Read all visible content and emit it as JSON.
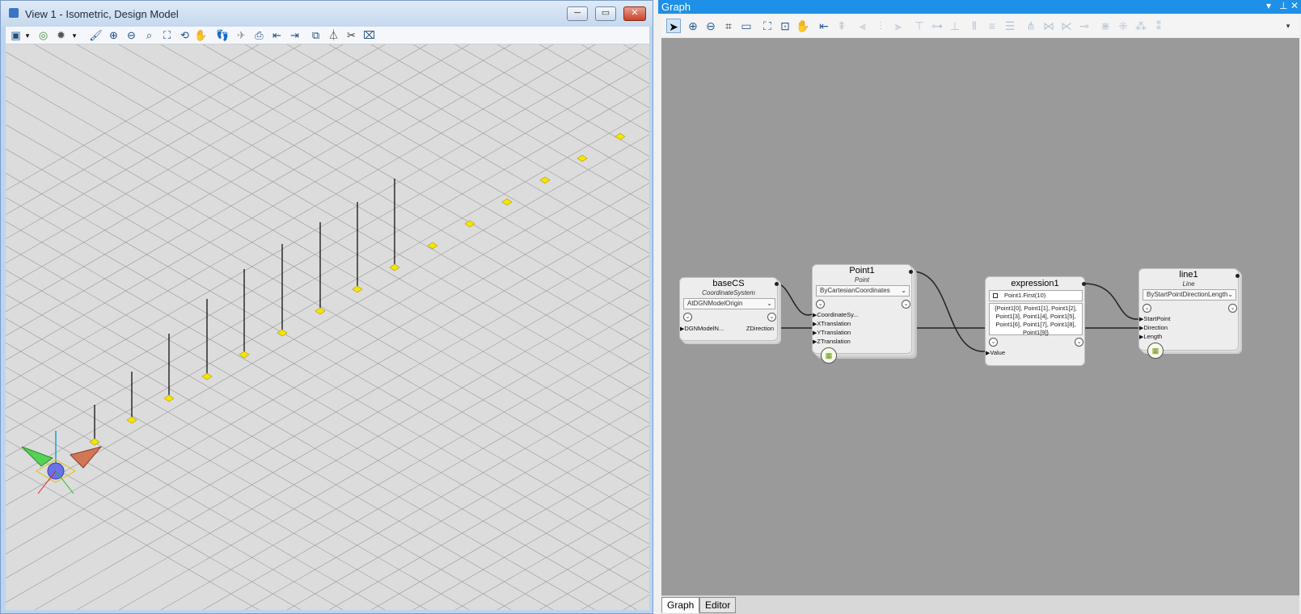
{
  "view_window": {
    "title": "View 1 - Isometric, Design Model",
    "buttons": {
      "minimize": "─",
      "restore": "▭",
      "close": "✕"
    },
    "toolbar_icons": [
      "view-attributes-icon",
      "dropdown-icon",
      "display-style-icon",
      "light-icon",
      "dropdown-icon",
      "brush-icon",
      "zoom-in-icon",
      "zoom-out-icon",
      "window-area-icon",
      "fit-view-icon",
      "rotate-view-icon",
      "pan-icon",
      "walk-icon",
      "fly-icon",
      "camera-icon",
      "previous-view-icon",
      "next-view-icon",
      "view-cube-icon",
      "clip-volume-icon",
      "clip-mask-icon",
      "clear-clip-icon"
    ],
    "point_color": "#f5e600",
    "line_color": "#000000"
  },
  "graph_window": {
    "title": "Graph",
    "controls": {
      "dropdown": "▾",
      "pin": "⊥",
      "close": "✕"
    },
    "canvas_color": "#9a9a9a",
    "tabs": [
      {
        "label": "Graph",
        "active": true
      },
      {
        "label": "Editor",
        "active": false
      }
    ]
  },
  "nodes": {
    "baseCS": {
      "title": "baseCS",
      "type": "CoordinateSystem",
      "technique": "AtDGNModelOrigin",
      "inputs": [
        "DGNModelN..."
      ],
      "outputs": [
        "ZDirection"
      ]
    },
    "point1": {
      "title": "Point1",
      "type": "Point",
      "technique": "ByCartesianCoordinates",
      "inputs": [
        "CoordinateSy...",
        "XTranslation",
        "YTranslation",
        "ZTranslation"
      ]
    },
    "expression1": {
      "title": "expression1",
      "expression": "Point1.First(10)",
      "result": "{Point1[0], Point1[1], Point1[2], Point1[3], Point1[4], Point1[5], Point1[6], Point1[7], Point1[8], Point1[9]}",
      "inputs": [
        "Value"
      ]
    },
    "line1": {
      "title": "line1",
      "type": "Line",
      "technique": "ByStartPointDirectionLength",
      "inputs": [
        "StartPoint",
        "Direction",
        "Length"
      ]
    }
  }
}
